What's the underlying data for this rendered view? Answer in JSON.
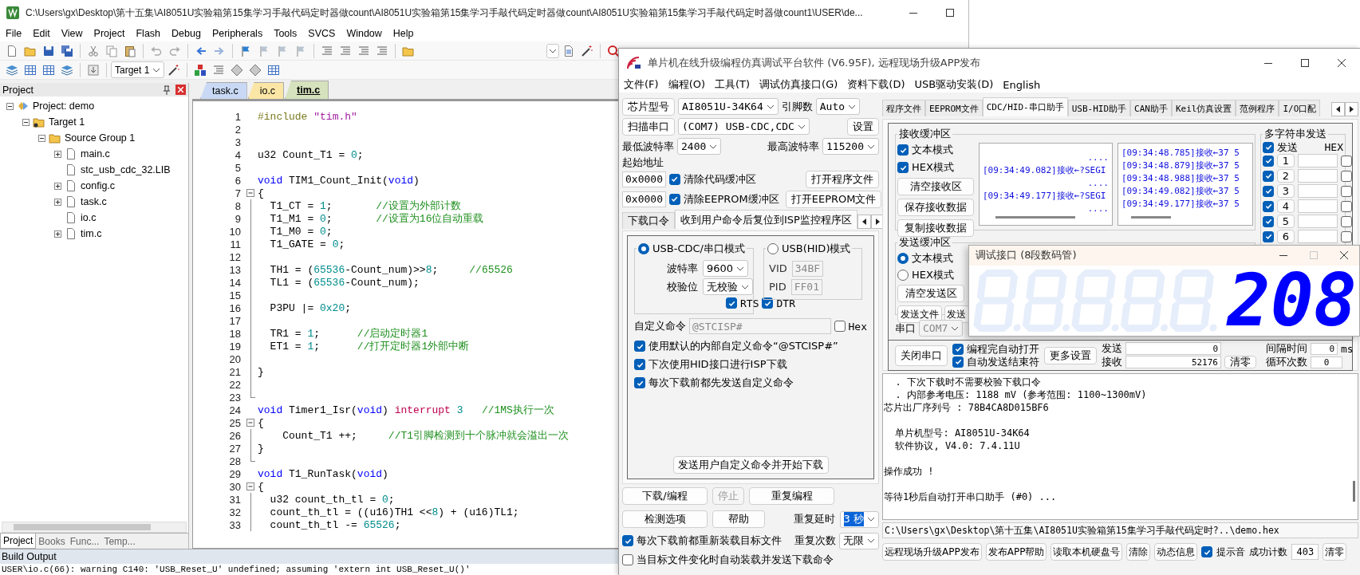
{
  "keil": {
    "title": "C:\\Users\\gx\\Desktop\\第十五集\\AI8051U实验箱第15集学习手敲代码定时器做count\\AI8051U实验箱第15集学习手敲代码定时器做count\\AI8051U实验箱第15集学习手敲代码定时器做count1\\USER\\de...",
    "menu": [
      "File",
      "Edit",
      "View",
      "Project",
      "Flash",
      "Debug",
      "Peripherals",
      "Tools",
      "SVCS",
      "Window",
      "Help"
    ],
    "target": "Target 1",
    "project_panel": {
      "title": "Project",
      "tree": [
        {
          "label": "Project: demo",
          "kind": "project",
          "expanded": true,
          "children": [
            {
              "label": "Target 1",
              "kind": "target",
              "expanded": true,
              "children": [
                {
                  "label": "Source Group 1",
                  "kind": "folder",
                  "expanded": true,
                  "children": [
                    {
                      "label": "main.c",
                      "kind": "file",
                      "expanded": false
                    },
                    {
                      "label": "stc_usb_cdc_32.LIB",
                      "kind": "file"
                    },
                    {
                      "label": "config.c",
                      "kind": "file",
                      "expanded": false
                    },
                    {
                      "label": "task.c",
                      "kind": "file",
                      "expanded": false
                    },
                    {
                      "label": "io.c",
                      "kind": "file"
                    },
                    {
                      "label": "tim.c",
                      "kind": "file",
                      "expanded": false
                    }
                  ]
                }
              ]
            }
          ]
        }
      ]
    },
    "panel_tabs": [
      {
        "label": "Project",
        "selected": true
      },
      {
        "label": "Books",
        "selected": false
      },
      {
        "label": "Func...",
        "selected": false
      },
      {
        "label": "Temp...",
        "selected": false
      }
    ],
    "editor_tabs": [
      {
        "label": "task.c",
        "selected": false,
        "color": "#c9d9f5"
      },
      {
        "label": "io.c",
        "selected": false,
        "color": "#fbe6a6"
      },
      {
        "label": "tim.c",
        "selected": true,
        "color": "#d5e2bd"
      }
    ],
    "code_lines": [
      {
        "number": "1",
        "kind": "plain",
        "segments": [
          {
            "kind": "pp",
            "text": "#include"
          },
          {
            "kind": "str",
            "text": " \"tim.h\""
          }
        ]
      },
      {
        "number": "2",
        "kind": "plain"
      },
      {
        "number": "3",
        "kind": "plain"
      },
      {
        "number": "4",
        "kind": "plain",
        "segments": [
          {
            "kind": "t",
            "text": "u32 Count_T1 = "
          },
          {
            "kind": "num",
            "text": "0"
          },
          {
            "kind": "t",
            "text": ";"
          }
        ]
      },
      {
        "number": "5",
        "kind": "plain"
      },
      {
        "number": "6",
        "kind": "plain",
        "segments": [
          {
            "kind": "kw",
            "text": "void"
          },
          {
            "kind": "t",
            "text": " TIM1_Count_Init("
          },
          {
            "kind": "kw",
            "text": "void"
          },
          {
            "kind": "t",
            "text": ")"
          }
        ]
      },
      {
        "number": "7",
        "kind": "fold_start",
        "segments": [
          {
            "kind": "t",
            "text": "{"
          }
        ]
      },
      {
        "number": "8",
        "kind": "fold_body",
        "segments": [
          {
            "kind": "t",
            "text": "  T1_CT = "
          },
          {
            "kind": "num",
            "text": "1"
          },
          {
            "kind": "t",
            "text": ";       "
          },
          {
            "kind": "cm",
            "text": "//设置为外部计数"
          }
        ]
      },
      {
        "number": "9",
        "kind": "fold_body",
        "segments": [
          {
            "kind": "t",
            "text": "  T1_M1 = "
          },
          {
            "kind": "num",
            "text": "0"
          },
          {
            "kind": "t",
            "text": ";       "
          },
          {
            "kind": "cm",
            "text": "//设置为16位自动重载"
          }
        ]
      },
      {
        "number": "10",
        "kind": "fold_body",
        "segments": [
          {
            "kind": "t",
            "text": "  T1_M0 = "
          },
          {
            "kind": "num",
            "text": "0"
          },
          {
            "kind": "t",
            "text": ";"
          }
        ]
      },
      {
        "number": "11",
        "kind": "fold_body",
        "segments": [
          {
            "kind": "t",
            "text": "  T1_GATE = "
          },
          {
            "kind": "num",
            "text": "0"
          },
          {
            "kind": "t",
            "text": ";"
          }
        ]
      },
      {
        "number": "12",
        "kind": "fold_body"
      },
      {
        "number": "13",
        "kind": "fold_body",
        "segments": [
          {
            "kind": "t",
            "text": "  TH1 = ("
          },
          {
            "kind": "num",
            "text": "65536"
          },
          {
            "kind": "t",
            "text": "-Count_num)>>"
          },
          {
            "kind": "num",
            "text": "8"
          },
          {
            "kind": "t",
            "text": ";     "
          },
          {
            "kind": "cm",
            "text": "//65526"
          }
        ]
      },
      {
        "number": "14",
        "kind": "fold_body",
        "segments": [
          {
            "kind": "t",
            "text": "  TL1 = ("
          },
          {
            "kind": "num",
            "text": "65536"
          },
          {
            "kind": "t",
            "text": "-Count_num);"
          }
        ]
      },
      {
        "number": "15",
        "kind": "fold_body"
      },
      {
        "number": "16",
        "kind": "fold_body",
        "segments": [
          {
            "kind": "t",
            "text": "  P3PU |= "
          },
          {
            "kind": "num",
            "text": "0x20"
          },
          {
            "kind": "t",
            "text": ";"
          }
        ]
      },
      {
        "number": "17",
        "kind": "fold_body"
      },
      {
        "number": "18",
        "kind": "fold_body",
        "segments": [
          {
            "kind": "t",
            "text": "  TR1 = "
          },
          {
            "kind": "num",
            "text": "1"
          },
          {
            "kind": "t",
            "text": ";      "
          },
          {
            "kind": "cm",
            "text": "//启动定时器1"
          }
        ]
      },
      {
        "number": "19",
        "kind": "fold_body",
        "segments": [
          {
            "kind": "t",
            "text": "  ET1 = "
          },
          {
            "kind": "num",
            "text": "1"
          },
          {
            "kind": "t",
            "text": ";      "
          },
          {
            "kind": "cm",
            "text": "//打开定时器1外部中断"
          }
        ]
      },
      {
        "number": "20",
        "kind": "fold_body"
      },
      {
        "number": "21",
        "kind": "fold_body",
        "segments": [
          {
            "kind": "t",
            "text": "}"
          }
        ]
      },
      {
        "number": "22",
        "kind": "fold_body"
      },
      {
        "number": "23",
        "kind": "fold_end"
      },
      {
        "number": "24",
        "kind": "plain",
        "segments": [
          {
            "kind": "kw",
            "text": "void"
          },
          {
            "kind": "t",
            "text": " Timer1_Isr("
          },
          {
            "kind": "kw",
            "text": "void"
          },
          {
            "kind": "t",
            "text": ") "
          },
          {
            "kind": "kw2",
            "text": "interrupt"
          },
          {
            "kind": "num",
            "text": " 3"
          },
          {
            "kind": "cm",
            "text": "   //1MS执行一次"
          }
        ]
      },
      {
        "number": "25",
        "kind": "fold_start",
        "segments": [
          {
            "kind": "t",
            "text": "{"
          }
        ]
      },
      {
        "number": "26",
        "kind": "fold_body",
        "segments": [
          {
            "kind": "t",
            "text": "    Count_T1 ++;     "
          },
          {
            "kind": "cm",
            "text": "//T1引脚检测到十个脉冲就会溢出一次"
          }
        ]
      },
      {
        "number": "27",
        "kind": "fold_body",
        "segments": [
          {
            "kind": "t",
            "text": "}"
          }
        ]
      },
      {
        "number": "28",
        "kind": "fold_end"
      },
      {
        "number": "29",
        "kind": "plain",
        "segments": [
          {
            "kind": "kw",
            "text": "void"
          },
          {
            "kind": "t",
            "text": " T1_RunTask("
          },
          {
            "kind": "kw",
            "text": "void"
          },
          {
            "kind": "t",
            "text": ")"
          }
        ]
      },
      {
        "number": "30",
        "kind": "fold_start",
        "segments": [
          {
            "kind": "t",
            "text": "{"
          }
        ]
      },
      {
        "number": "31",
        "kind": "fold_body",
        "segments": [
          {
            "kind": "t",
            "text": "  u32 count_th_tl = "
          },
          {
            "kind": "num",
            "text": "0"
          },
          {
            "kind": "t",
            "text": ";"
          }
        ]
      },
      {
        "number": "32",
        "kind": "fold_body",
        "segments": [
          {
            "kind": "t",
            "text": "  count_th_tl = ((u16)TH1 <<"
          },
          {
            "kind": "num",
            "text": "8"
          },
          {
            "kind": "t",
            "text": ") + (u16)TL1;"
          }
        ]
      },
      {
        "number": "33",
        "kind": "fold_body",
        "segments": [
          {
            "kind": "t",
            "text": "  count_th_tl -= "
          },
          {
            "kind": "num",
            "text": "65526"
          },
          {
            "kind": "t",
            "text": ";"
          }
        ]
      }
    ],
    "build_output": {
      "title": "Build Output",
      "lines": [
        "USER\\io.c(66): warning C140: 'USB_Reset_U' undefined; assuming 'extern int USB_Reset_U()'"
      ]
    }
  },
  "stc": {
    "title": "单片机在线升级编程仿真调试平台软件 (V6.95F), 远程现场升级APP发布",
    "menu": [
      "文件(F)",
      "编程(O)",
      "工具(T)",
      "调试仿真接口(G)",
      "资料下载(D)",
      "USB驱动安装(D)",
      "English"
    ],
    "chip_button": "芯片型号",
    "chip": "AI8051U-34K64",
    "pins_label": "引脚数",
    "pins": "Auto",
    "scan_button": "扫描串口",
    "port": "(COM7) USB-CDC,CDC",
    "settings_button": "设置",
    "min_baud_label": "最低波特率",
    "min_baud": "2400",
    "max_baud_label": "最高波特率",
    "max_baud": "115200",
    "start_address_label": "起始地址",
    "address_rows": [
      {
        "address": "0x0000",
        "label": "清除代码缓冲区",
        "checked": true,
        "button": "打开程序文件"
      },
      {
        "address": "0x0000",
        "label": "清除EEPROM缓冲区",
        "checked": true,
        "button": "打开EEPROM文件"
      }
    ],
    "tabs": [
      {
        "label": "下载口令",
        "selected": false
      },
      {
        "label": "收到用户命令后复位到ISP监控程序区",
        "selected": true
      }
    ],
    "modes": [
      {
        "label": "USB-CDC/串口模式",
        "selected": true,
        "fields": [
          {
            "label": "波特率",
            "value": "9600",
            "kind": "dropdown"
          },
          {
            "label": "校验位",
            "value": "无校验",
            "kind": "dropdown"
          }
        ],
        "checks": [
          {
            "label": "RTS",
            "checked": true
          },
          {
            "label": "DTR",
            "checked": true
          }
        ]
      },
      {
        "label": "USB(HID)模式",
        "selected": false,
        "fields": [
          {
            "label": "VID",
            "value": "34BF",
            "kind": "text"
          },
          {
            "label": "PID",
            "value": "FF01",
            "kind": "text"
          }
        ]
      }
    ],
    "custom_command": {
      "label": "自定义命令",
      "value": "@STCISP#",
      "disabled": true,
      "hex_label": "Hex",
      "hex_checked": false
    },
    "options": [
      {
        "label": "使用默认的内部自定义命令“@STCISP#”",
        "checked": true
      },
      {
        "label": "下次使用HID接口进行ISP下载",
        "checked": true
      },
      {
        "label": "每次下载前都先发送自定义命令",
        "checked": true
      }
    ],
    "send_button": "发送用户自定义命令并开始下载",
    "actions": [
      {
        "label": "下载/编程",
        "disabled": false
      },
      {
        "label": "停止",
        "disabled": true
      },
      {
        "label": "重复编程",
        "disabled": false
      },
      {
        "label": "检测选项",
        "disabled": false
      },
      {
        "label": "帮助",
        "disabled": false
      }
    ],
    "repeat_delay": {
      "label": "重复延时",
      "value": "3 秒",
      "highlighted": true
    },
    "repeat_count": {
      "label": "重复次数",
      "value": "无限"
    },
    "bottom_checks": [
      {
        "label": "每次下载前都重新装载目标文件",
        "checked": true
      },
      {
        "label": "当目标文件变化时自动装载并发送下载命令",
        "checked": false
      }
    ],
    "right_tabs": [
      {
        "label": "程序文件",
        "selected": false
      },
      {
        "label": "EEPROM文件",
        "selected": false
      },
      {
        "label": "CDC/HID-串口助手",
        "selected": true
      },
      {
        "label": "USB-HID助手",
        "selected": false
      },
      {
        "label": "CAN助手",
        "selected": false
      },
      {
        "label": "Keil仿真设置",
        "selected": false
      },
      {
        "label": "范例程序",
        "selected": false
      },
      {
        "label": "I/O口配",
        "selected": false
      }
    ],
    "receive": {
      "title": "接收缓冲区",
      "modes": [
        {
          "label": "文本模式",
          "checked": true
        },
        {
          "label": "HEX模式",
          "checked": true
        }
      ],
      "buttons": [
        "清空接收区",
        "保存接收数据",
        "复制接收数据"
      ],
      "text_lines": [
        "....",
        "[09:34:49.082]接收←?SEGI",
        "....",
        "[09:34:49.177]接收←?SEGI",
        "...."
      ],
      "hex_lines": [
        "[09:34:48.785]接收←37 5",
        "[09:34:48.879]接收←37 5",
        "[09:34:48.988]接收←37 5",
        "[09:34:49.082]接收←37 5",
        "[09:34:49.177]接收←37 5"
      ]
    },
    "multi_send": {
      "title": "多字符串发送",
      "send_label": "发送",
      "send_checked": true,
      "hex_label": "HEX",
      "rows": [
        {
          "number": "1",
          "checked": true,
          "hex": false
        },
        {
          "number": "2",
          "checked": true,
          "hex": false
        },
        {
          "number": "3",
          "checked": true,
          "hex": false
        },
        {
          "number": "4",
          "checked": true,
          "hex": false
        },
        {
          "number": "5",
          "checked": true,
          "hex": false
        },
        {
          "number": "6",
          "checked": true,
          "hex": false
        }
      ]
    },
    "send": {
      "title": "发送缓冲区",
      "modes": [
        {
          "label": "文本模式",
          "selected": true
        },
        {
          "label": "HEX模式",
          "selected": false
        }
      ],
      "clear_button": "清空发送区",
      "buttons": [
        "发送文件",
        "发送"
      ]
    },
    "serial": {
      "label": "串口",
      "value": "COM7",
      "disabled": true
    },
    "close_port_button": "关闭串口",
    "port_checks": [
      {
        "label": "编程完自动打开",
        "checked": true
      },
      {
        "label": "自动发送结束符",
        "checked": true
      }
    ],
    "more_button": "更多设置",
    "counters": [
      {
        "label": "发送",
        "value": "0"
      },
      {
        "label": "接收",
        "value": "52176"
      }
    ],
    "clear_counter_button": "清零",
    "interval": {
      "label": "间隔时间",
      "value": "0",
      "unit": "ms"
    },
    "loops": {
      "label": "循环次数",
      "value": "0"
    },
    "log": [
      [
        "  . 下次下载时不需要校验下载口令",
        "  . 内部参考电压: 1188 mV (参考范围: 1100~1300mV)",
        "芯片出厂序列号 : 78B4CA8D015BF6"
      ],
      [
        "  单片机型号: AI8051U-34K64",
        "  软件协议, V4.0: 7.4.11U"
      ],
      [
        "操作成功 !"
      ],
      [
        "等待1秒后自动打开串口助手 (#0) ..."
      ]
    ],
    "file_path": "C:\\Users\\gx\\Desktop\\第十五集\\AI8051U实验箱第15集学习手敲代码定时?..\\demo.hex",
    "footer_buttons": [
      "远程现场升级APP发布",
      "发布APP帮助",
      "读取本机硬盘号",
      "清除",
      "动态信息"
    ],
    "beep": {
      "label": "提示音",
      "checked": true
    },
    "success": {
      "label": "成功计数",
      "value": "403"
    },
    "success_clear": "清零"
  },
  "seven_segment": {
    "title": "调试接口 (8段数码管)",
    "value": "208",
    "maximize_disabled": true
  }
}
